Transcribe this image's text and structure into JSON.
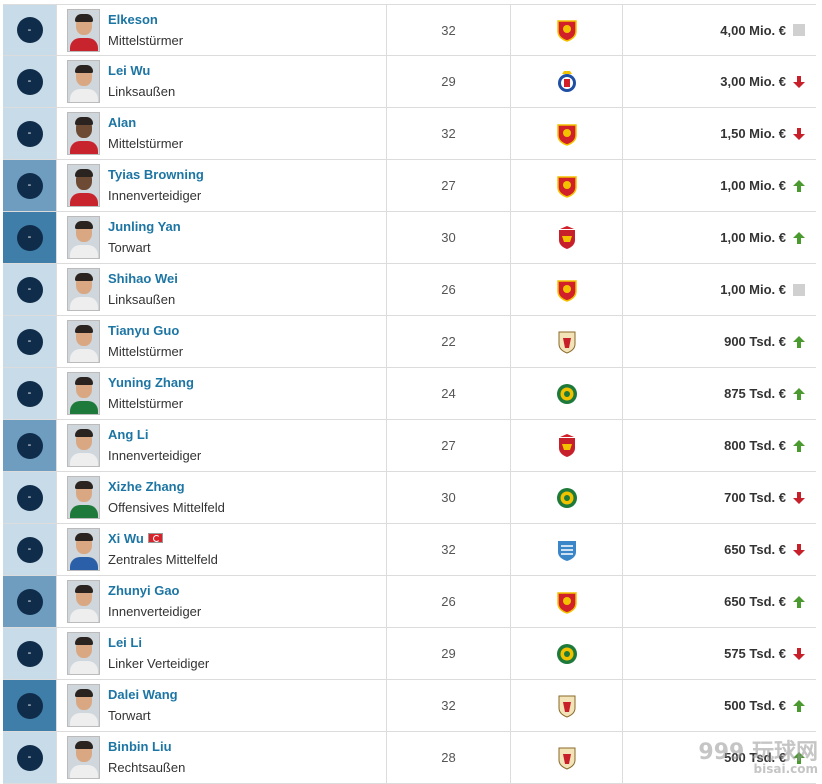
{
  "players": [
    {
      "position": "-",
      "name": "Elkeson",
      "role": "Mittelstürmer",
      "age": "32",
      "club_icon": "guangzhou-crest",
      "value": "4,00 Mio. €",
      "trend": "unchanged"
    },
    {
      "position": "-",
      "name": "Lei Wu",
      "role": "Linksaußen",
      "age": "29",
      "club_icon": "espanyol-crest",
      "value": "3,00 Mio. €",
      "trend": "down"
    },
    {
      "position": "-",
      "name": "Alan",
      "role": "Mittelstürmer",
      "age": "32",
      "club_icon": "guangzhou-crest",
      "value": "1,50 Mio. €",
      "trend": "down"
    },
    {
      "position": "-",
      "name": "Tyias Browning",
      "role": "Innenverteidiger",
      "age": "27",
      "club_icon": "guangzhou-crest",
      "value": "1,00 Mio. €",
      "trend": "up"
    },
    {
      "position": "-",
      "name": "Junling Yan",
      "role": "Torwart",
      "age": "30",
      "club_icon": "shanghai-port-crest",
      "value": "1,00 Mio. €",
      "trend": "up"
    },
    {
      "position": "-",
      "name": "Shihao Wei",
      "role": "Linksaußen",
      "age": "26",
      "club_icon": "guangzhou-crest",
      "value": "1,00 Mio. €",
      "trend": "unchanged"
    },
    {
      "position": "-",
      "name": "Tianyu Guo",
      "role": "Mittelstürmer",
      "age": "22",
      "club_icon": "shandong-crest",
      "value": "900 Tsd. €",
      "trend": "up"
    },
    {
      "position": "-",
      "name": "Yuning Zhang",
      "role": "Mittelstürmer",
      "age": "24",
      "club_icon": "beijing-guoan-crest",
      "value": "875 Tsd. €",
      "trend": "up"
    },
    {
      "position": "-",
      "name": "Ang Li",
      "role": "Innenverteidiger",
      "age": "27",
      "club_icon": "shanghai-port-crest",
      "value": "800 Tsd. €",
      "trend": "up"
    },
    {
      "position": "-",
      "name": "Xizhe Zhang",
      "role": "Offensives Mittelfeld",
      "age": "30",
      "club_icon": "beijing-guoan-crest",
      "value": "700 Tsd. €",
      "trend": "down"
    },
    {
      "position": "-",
      "name": "Xi Wu",
      "role": "Zentrales Mittelfeld",
      "age": "32",
      "club_icon": "shanghai-shenhua-crest",
      "value": "650 Tsd. €",
      "trend": "down",
      "flag": "turkey-flag-icon"
    },
    {
      "position": "-",
      "name": "Zhunyi Gao",
      "role": "Innenverteidiger",
      "age": "26",
      "club_icon": "guangzhou-crest",
      "value": "650 Tsd. €",
      "trend": "up"
    },
    {
      "position": "-",
      "name": "Lei Li",
      "role": "Linker Verteidiger",
      "age": "29",
      "club_icon": "beijing-guoan-crest",
      "value": "575 Tsd. €",
      "trend": "down"
    },
    {
      "position": "-",
      "name": "Dalei Wang",
      "role": "Torwart",
      "age": "32",
      "club_icon": "shandong-crest",
      "value": "500 Tsd. €",
      "trend": "up"
    },
    {
      "position": "-",
      "name": "Binbin Liu",
      "role": "Rechtsaußen",
      "age": "28",
      "club_icon": "shandong-crest",
      "value": "500 Tsd. €",
      "trend": "up"
    }
  ],
  "colors": {
    "link": "#1d75a3",
    "trend_up": "#4a9a2f",
    "trend_down": "#c8202a",
    "badge": "#0f2d4a"
  },
  "watermark": {
    "line1": "999 玩球网",
    "line2": "bisai.com"
  }
}
